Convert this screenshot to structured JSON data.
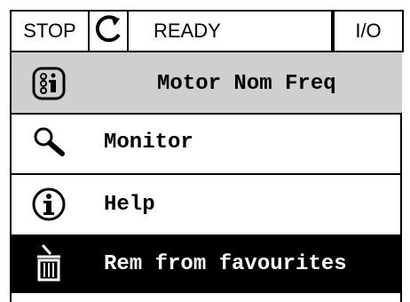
{
  "status_bar": {
    "state": "STOP",
    "mode": "READY",
    "control": "I/O",
    "rotation_icon": "rotation-arrow-icon"
  },
  "title": {
    "text": "Motor Nom Freq",
    "icon": "parameter-info-icon"
  },
  "menu": {
    "items": [
      {
        "label": "Monitor",
        "icon": "magnifier-icon"
      },
      {
        "label": "Help",
        "icon": "info-icon"
      },
      {
        "label": "Rem from favourites",
        "icon": "trash-icon"
      }
    ]
  },
  "colors": {
    "title_background": "#cfcfcf",
    "selected_background": "#000000",
    "selected_text": "#ffffff"
  }
}
